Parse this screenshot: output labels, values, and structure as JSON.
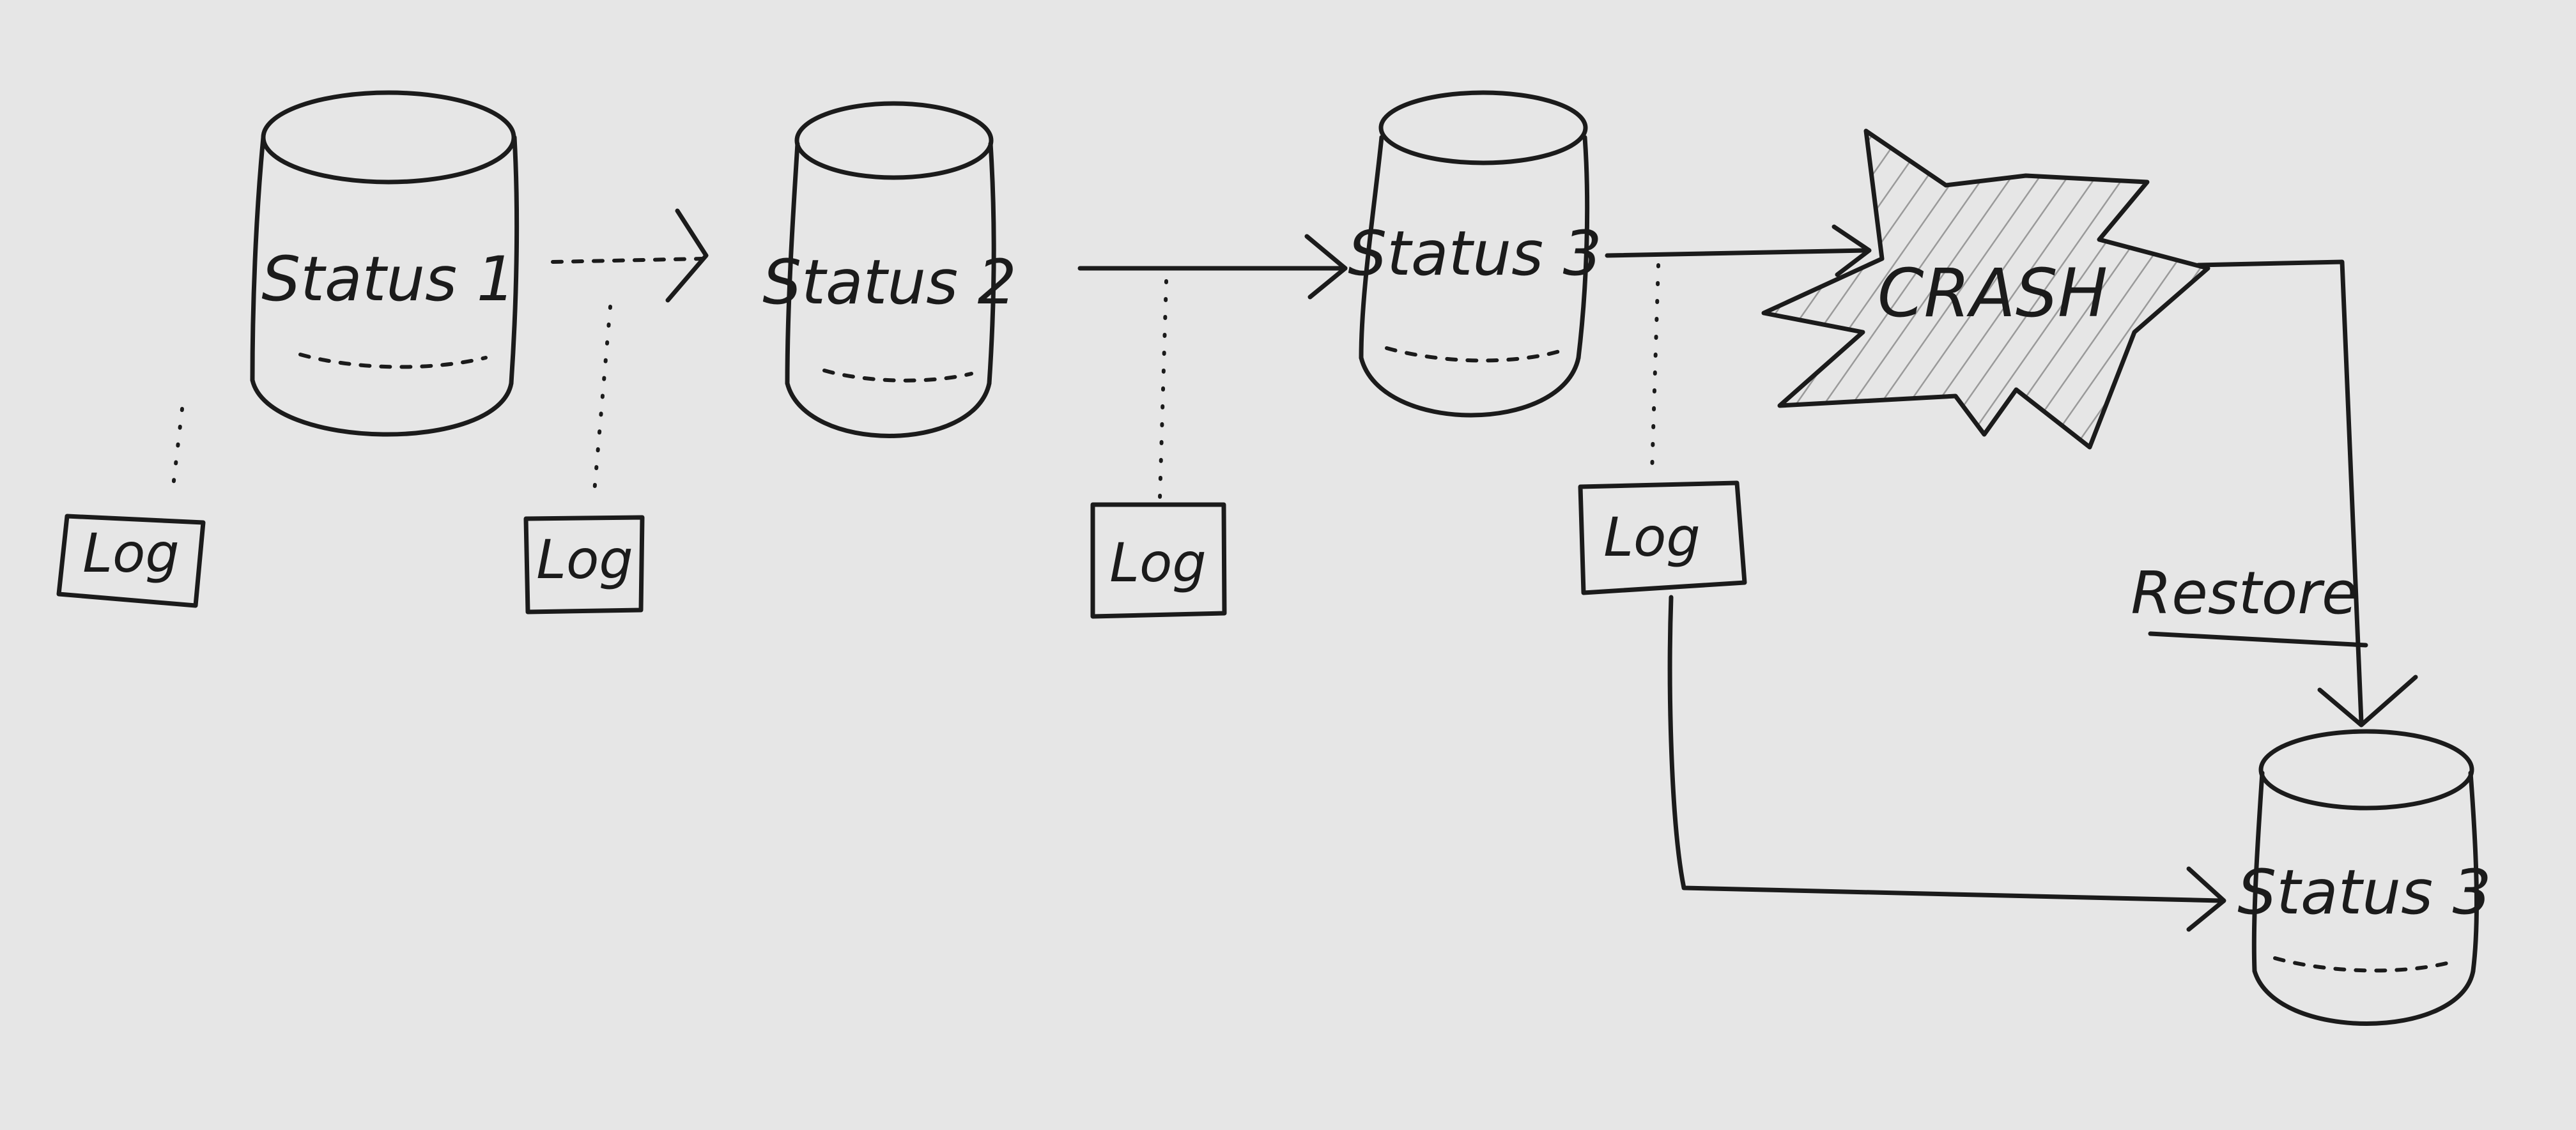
{
  "diagram": {
    "databases": [
      {
        "id": "db1",
        "label": "Status 1"
      },
      {
        "id": "db2",
        "label": "Status 2"
      },
      {
        "id": "db3",
        "label": "Status 3"
      },
      {
        "id": "db4",
        "label": "Status 3"
      }
    ],
    "logs": [
      {
        "id": "log1",
        "label": "Log"
      },
      {
        "id": "log2",
        "label": "Log"
      },
      {
        "id": "log3",
        "label": "Log"
      },
      {
        "id": "log4",
        "label": "Log"
      }
    ],
    "crash": {
      "label": "CRASH"
    },
    "restore": {
      "label": "Restore"
    },
    "colors": {
      "background": "#e6e6e6",
      "ink": "#1b1b1b",
      "hatch": "#9a9a9a"
    }
  }
}
